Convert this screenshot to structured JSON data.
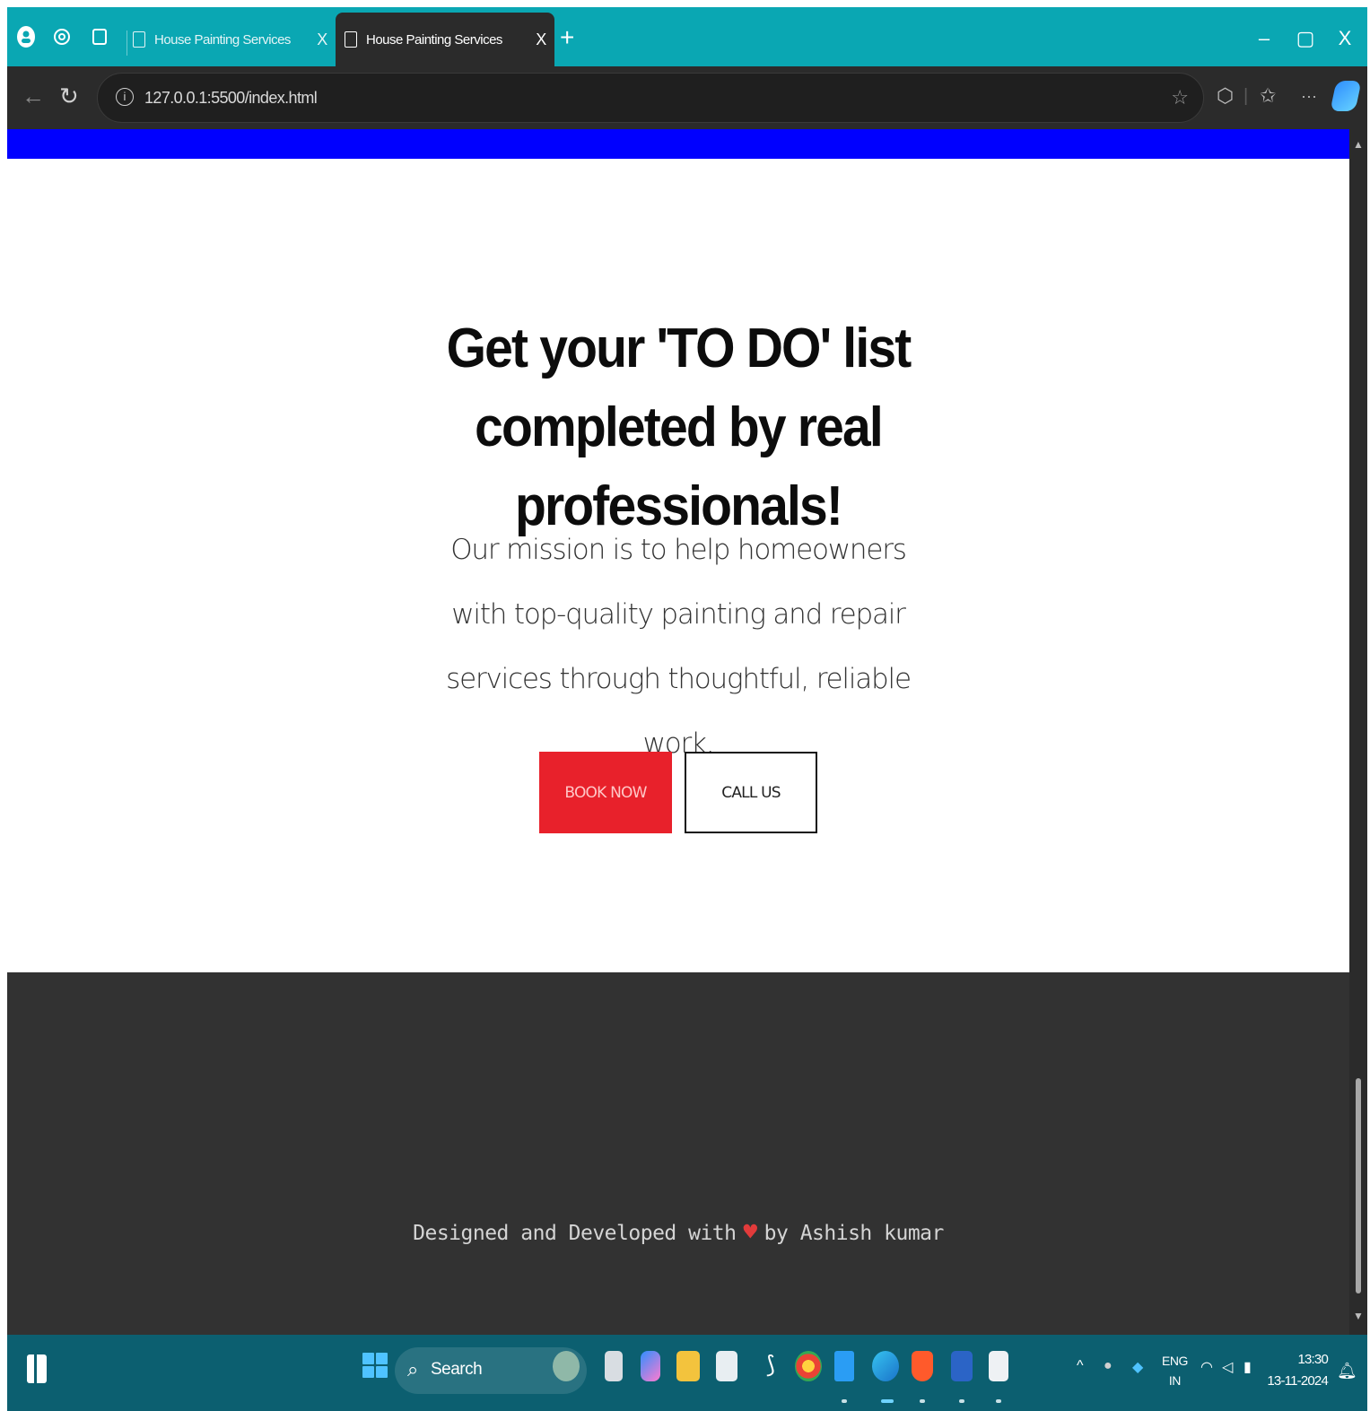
{
  "browser": {
    "tabs": [
      {
        "label": "House Painting Services",
        "close": "X",
        "active": false
      },
      {
        "label": "House Painting Services",
        "close": "X",
        "active": true
      }
    ],
    "new_tab": "+",
    "window_controls": {
      "minimize": "–",
      "restore": "▢",
      "close": "X"
    },
    "url": "127.0.0.1:5500/index.html",
    "url_info": "i",
    "menu": "···"
  },
  "page": {
    "top_band_color": "#0000ff",
    "headline": "Get your 'TO DO' list completed by real professionals!",
    "mission": "Our mission is to help homeowners with top-quality painting and repair services through thoughtful, reliable work.",
    "buttons": {
      "book": "BOOK NOW",
      "call": "CALL US"
    },
    "accent_color": "#e8212b",
    "footer": {
      "credit_prefix": "Designed and Developed with",
      "credit_suffix": "by Ashish kumar",
      "heart": "♥",
      "background": "#323232"
    }
  },
  "taskbar": {
    "search_label": "Search",
    "language_line1": "ENG",
    "language_line2": "IN",
    "time": "13:30",
    "date": "13-11-2024",
    "chevron": "^"
  }
}
